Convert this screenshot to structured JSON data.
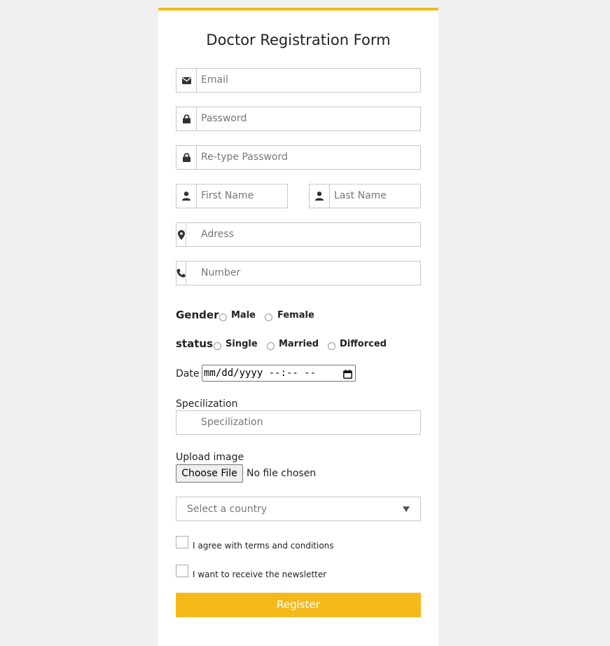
{
  "form": {
    "title": "Doctor Registration Form",
    "email_placeholder": "Email",
    "password_placeholder": "Password",
    "retype_password_placeholder": "Re-type Password",
    "first_name_placeholder": "First Name",
    "last_name_placeholder": "Last Name",
    "address_placeholder": "Adress",
    "number_placeholder": "Number",
    "gender": {
      "label": "Gender",
      "options": [
        "Male",
        "Female"
      ]
    },
    "status": {
      "label": "status",
      "options": [
        "Single",
        "Married",
        "Difforced"
      ]
    },
    "date": {
      "label": "Date",
      "value": "mm/dd/yyyy --:-- --"
    },
    "specialization": {
      "label": "Specilization",
      "placeholder": "Specilization"
    },
    "upload": {
      "label": "Upload image",
      "button": "Choose File",
      "status": "No file chosen"
    },
    "country": {
      "selected": "Select a country"
    },
    "terms_label": "I agree with terms and conditions",
    "newsletter_label": "I want to receive the newsletter",
    "register_label": "Register"
  },
  "colors": {
    "accent": "#f5ba1a",
    "background": "#f0f0f0",
    "card": "#ffffff"
  },
  "icons": [
    "envelope-icon",
    "lock-icon",
    "user-icon",
    "map-pin-icon",
    "phone-icon",
    "calendar-icon",
    "chevron-down-icon"
  ]
}
